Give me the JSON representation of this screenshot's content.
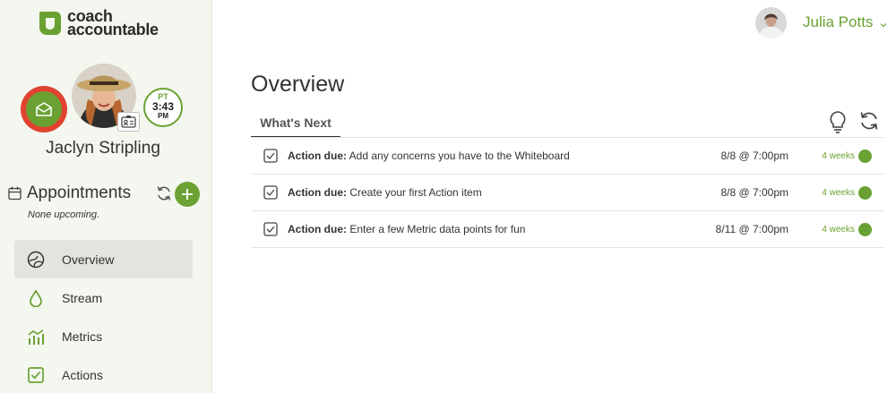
{
  "brand": {
    "line1": "coach",
    "line2": "accountable",
    "accent": "#6aa132",
    "alert": "#e0432f"
  },
  "client": {
    "name": "Jaclyn Stripling",
    "clock": {
      "tz": "PT",
      "time": "3:43",
      "ampm": "PM"
    }
  },
  "appointments": {
    "title": "Appointments",
    "none_text": "None upcoming."
  },
  "nav": {
    "items": [
      {
        "label": "Overview",
        "icon": "overview-icon",
        "active": true
      },
      {
        "label": "Stream",
        "icon": "drop-icon",
        "active": false
      },
      {
        "label": "Metrics",
        "icon": "metrics-icon",
        "active": false
      },
      {
        "label": "Actions",
        "icon": "checkbox-icon",
        "active": false
      }
    ]
  },
  "header": {
    "user_name": "Julia Potts"
  },
  "main": {
    "title": "Overview",
    "tab": "What's Next",
    "rows": [
      {
        "prefix": "Action due:",
        "text": "Add any concerns you have to the Whiteboard",
        "date": "8/8 @ 7:00pm",
        "due": "4 weeks"
      },
      {
        "prefix": "Action due:",
        "text": "Create your first Action item",
        "date": "8/8 @ 7:00pm",
        "due": "4 weeks"
      },
      {
        "prefix": "Action due:",
        "text": "Enter a few Metric data points for fun",
        "date": "8/11 @ 7:00pm",
        "due": "4 weeks"
      }
    ]
  }
}
